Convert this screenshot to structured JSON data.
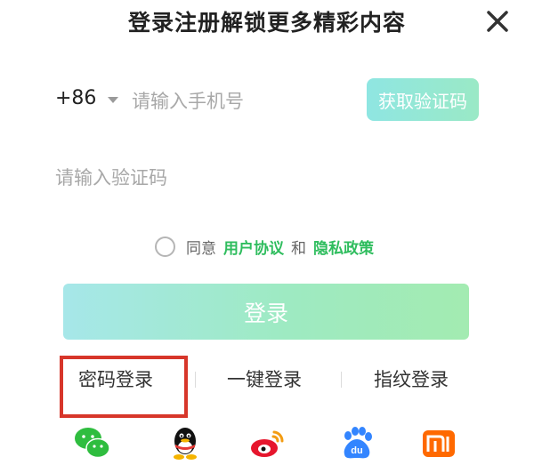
{
  "header": {
    "title": "登录注册解锁更多精彩内容",
    "close_icon": "close-icon"
  },
  "phone": {
    "country_code": "+86",
    "placeholder": "请输入手机号",
    "get_code_label": "获取验证码"
  },
  "verify": {
    "placeholder": "请输入验证码"
  },
  "agreement": {
    "prefix": "同意",
    "user_agreement": "用户协议",
    "conj": "和",
    "privacy_policy": "隐私政策"
  },
  "login": {
    "label": "登录"
  },
  "login_modes": {
    "password": "密码登录",
    "one_click": "一键登录",
    "fingerprint": "指纹登录"
  },
  "social": [
    "wechat-icon",
    "qq-icon",
    "weibo-icon",
    "baidu-icon",
    "xiaomi-icon"
  ],
  "colors": {
    "accent_green": "#2fbd5e",
    "highlight_red": "#d7362a",
    "button_gradient_start": "#a6e7e9",
    "button_gradient_end": "#a3ebb1"
  }
}
